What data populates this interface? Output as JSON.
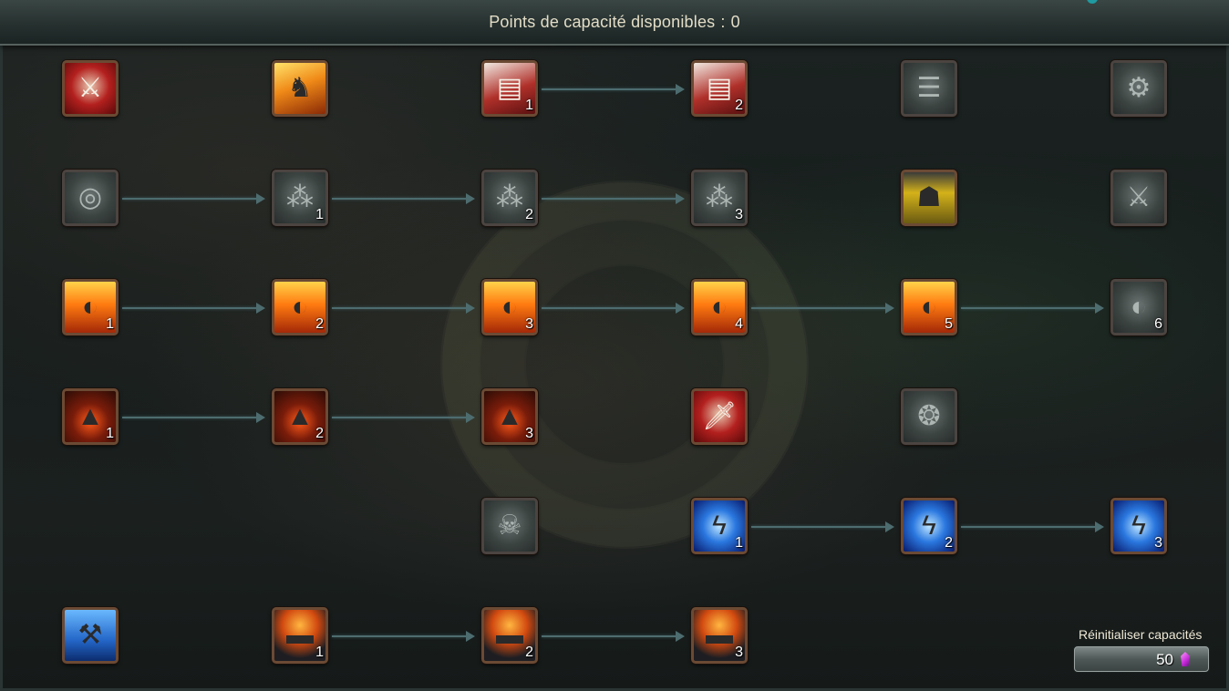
{
  "header": {
    "title": "Points de capacité disponibles",
    "separator": ":",
    "points": "0"
  },
  "reset": {
    "label": "Réinitialiser capacités",
    "cost": "50",
    "currency_icon": "purple-gem-icon"
  },
  "tree": {
    "rows": [
      [
        {
          "icon": "crossed-swords-icon",
          "rank": ""
        },
        {
          "icon": "goblin-rider-icon",
          "rank": ""
        },
        {
          "icon": "stacked-cards-icon",
          "rank": "1"
        },
        {
          "icon": "stacked-cards-icon",
          "rank": "2"
        },
        {
          "icon": "locked-engraving-icon",
          "rank": ""
        },
        {
          "icon": "locked-gear-icon",
          "rank": ""
        }
      ],
      [
        {
          "icon": "target-icon",
          "rank": ""
        },
        {
          "icon": "cannonballs-icon",
          "rank": "1"
        },
        {
          "icon": "cannonballs-icon",
          "rank": "2"
        },
        {
          "icon": "cannonballs-icon",
          "rank": "3"
        },
        {
          "icon": "robot-head-icon",
          "rank": ""
        },
        {
          "icon": "locked-blade-icon",
          "rank": ""
        }
      ],
      [
        {
          "icon": "shield-fan-icon",
          "rank": "1"
        },
        {
          "icon": "shield-fan-icon",
          "rank": "2"
        },
        {
          "icon": "shield-fan-icon",
          "rank": "3"
        },
        {
          "icon": "shield-fan-icon",
          "rank": "4"
        },
        {
          "icon": "shield-fan-icon",
          "rank": "5"
        },
        {
          "icon": "shield-fan-icon",
          "rank": "6"
        }
      ],
      [
        {
          "icon": "lava-armor-icon",
          "rank": "1"
        },
        {
          "icon": "lava-armor-icon",
          "rank": "2"
        },
        {
          "icon": "lava-armor-icon",
          "rank": "3"
        },
        {
          "icon": "dagger-icon",
          "rank": ""
        },
        {
          "icon": "locked-swirl-icon",
          "rank": ""
        }
      ],
      [
        {
          "icon": "skull-icon",
          "rank": ""
        },
        {
          "icon": "tesla-coil-icon",
          "rank": "1"
        },
        {
          "icon": "tesla-coil-icon",
          "rank": "2"
        },
        {
          "icon": "tesla-coil-icon",
          "rank": "3"
        }
      ],
      [
        {
          "icon": "hammer-icon",
          "rank": ""
        },
        {
          "icon": "anvil-icon",
          "rank": "1"
        },
        {
          "icon": "anvil-icon",
          "rank": "2"
        },
        {
          "icon": "anvil-icon",
          "rank": "3"
        }
      ]
    ]
  }
}
